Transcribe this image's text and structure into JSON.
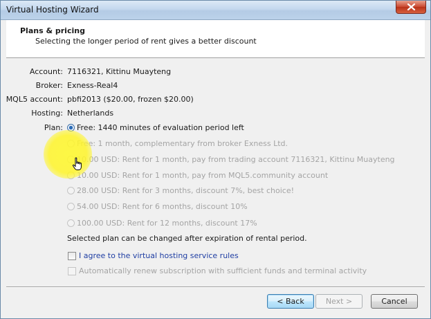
{
  "window": {
    "title": "Virtual Hosting Wizard"
  },
  "header": {
    "title": "Plans & pricing",
    "subtitle": "Selecting the longer period of rent gives a better discount"
  },
  "fields": [
    {
      "label": "Account:",
      "value": "7116321, Kittinu Muayteng"
    },
    {
      "label": "Broker:",
      "value": "Exness-Real4"
    },
    {
      "label": "MQL5 account:",
      "value": "pbfi2013 ($20.00, frozen $20.00)"
    },
    {
      "label": "Hosting:",
      "value": "Netherlands"
    }
  ],
  "plan": {
    "label": "Plan:",
    "options": [
      {
        "text": "Free: 1440 minutes of evaluation period left",
        "selected": true,
        "enabled": true
      },
      {
        "text": "Free: 1 month, complementary from broker Exness Ltd.",
        "selected": false,
        "enabled": false
      },
      {
        "text": "10.00 USD: Rent for 1 month, pay from trading account 7116321, Kittinu Muayteng",
        "selected": false,
        "enabled": false
      },
      {
        "text": "10.00 USD: Rent for 1 month, pay from MQL5.community account",
        "selected": false,
        "enabled": false
      },
      {
        "text": "28.00 USD: Rent for 3 months, discount 7%, best choice!",
        "selected": false,
        "enabled": false
      },
      {
        "text": "54.00 USD: Rent for 6 months, discount 10%",
        "selected": false,
        "enabled": false
      },
      {
        "text": "100.00 USD: Rent for 12 months, discount 17%",
        "selected": false,
        "enabled": false
      }
    ],
    "note": "Selected plan can be changed after expiration of rental period."
  },
  "checkboxes": {
    "agree": {
      "text": "I agree to the virtual hosting service rules",
      "checked": false
    },
    "renew": {
      "text": "Automatically renew subscription with sufficient funds and terminal activity",
      "checked": false,
      "enabled": false
    }
  },
  "buttons": {
    "back": "< Back",
    "next": "Next >",
    "cancel": "Cancel"
  },
  "colors": {
    "link": "#1f3ea3",
    "highlight": "#fff532",
    "close": "#c9472f"
  }
}
